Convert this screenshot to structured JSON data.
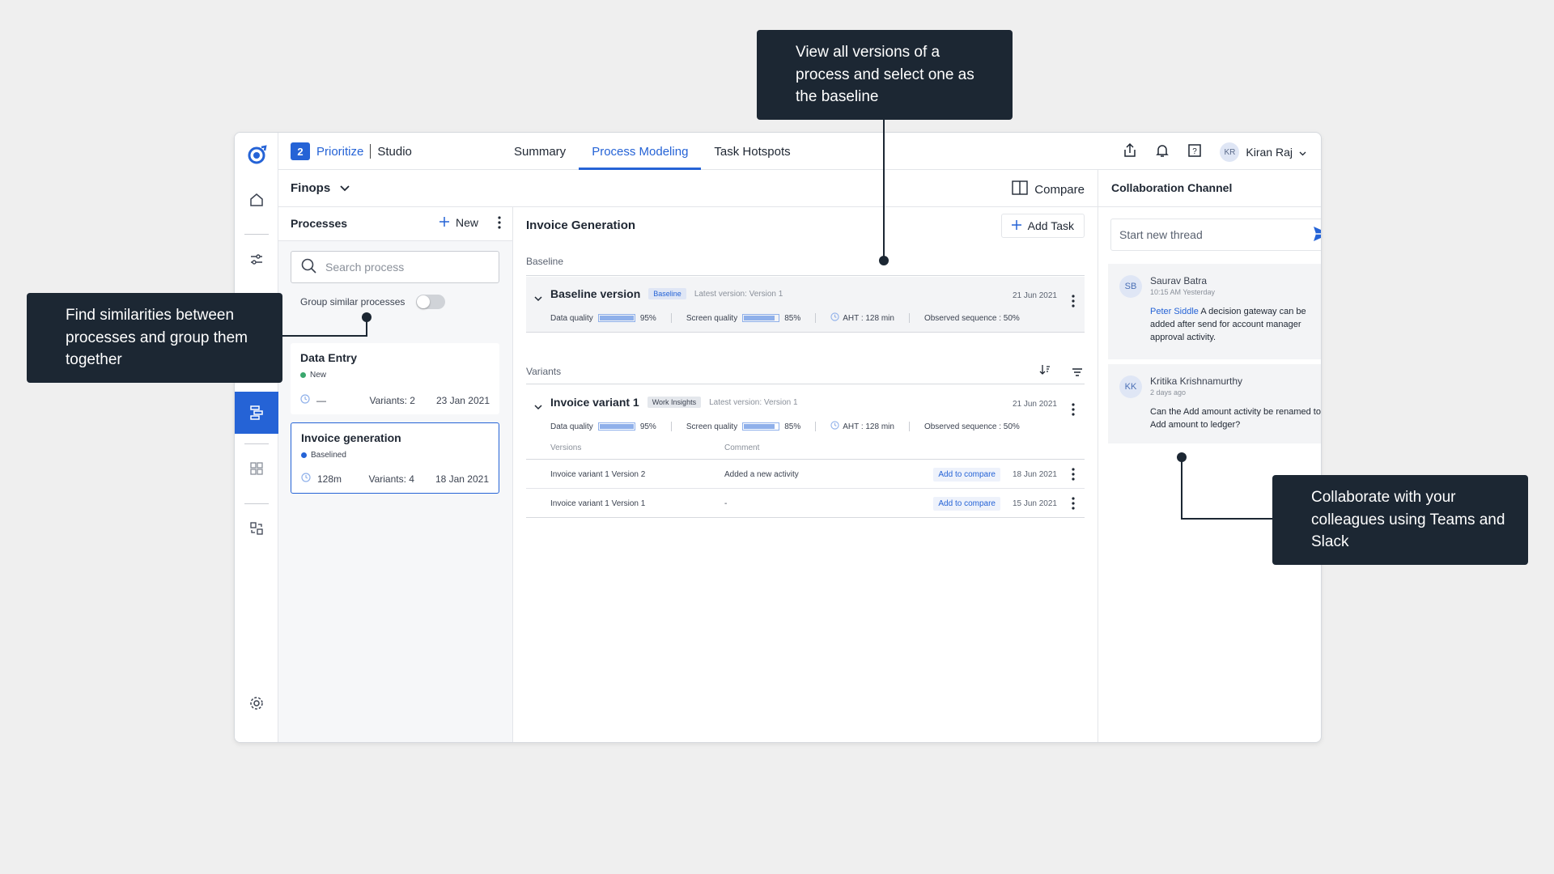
{
  "header": {
    "step_number": "2",
    "product_name": "Prioritize",
    "product_section": "Studio",
    "tabs": [
      {
        "label": "Summary"
      },
      {
        "label": "Process Modeling"
      },
      {
        "label": "Task Hotspots"
      }
    ],
    "user": {
      "initials": "KR",
      "name": "Kiran Raj"
    }
  },
  "workspace": {
    "selected": "Finops",
    "compare_label": "Compare"
  },
  "processes": {
    "title": "Processes",
    "new_label": "New",
    "search_placeholder": "Search process",
    "group_similar_label": "Group similar processes",
    "items": [
      {
        "name": "Data Entry",
        "status": "New",
        "status_color": "#3aa76d",
        "duration": "—",
        "variants": "Variants: 2",
        "date": "23 Jan 2021"
      },
      {
        "name": "Invoice generation",
        "status": "Baselined",
        "status_color": "#2563d6",
        "duration": "128m",
        "variants": "Variants: 4",
        "date": "18 Jan 2021"
      }
    ]
  },
  "detail": {
    "title": "Invoice Generation",
    "add_task_label": "Add Task",
    "baseline_section_label": "Baseline",
    "variants_section_label": "Variants",
    "baseline": {
      "name": "Baseline version",
      "badge": "Baseline",
      "latest": "Latest version: Version 1",
      "date": "21 Jun 2021",
      "data_quality_label": "Data quality",
      "data_quality": "95%",
      "data_quality_value": 0.95,
      "screen_quality_label": "Screen quality",
      "screen_quality": "85%",
      "screen_quality_value": 0.85,
      "aht": "AHT : 128 min",
      "observed": "Observed sequence : 50%"
    },
    "variant": {
      "name": "Invoice variant 1",
      "badge": "Work Insights",
      "latest": "Latest version: Version 1",
      "date": "21 Jun 2021",
      "data_quality_label": "Data quality",
      "data_quality": "95%",
      "data_quality_value": 0.95,
      "screen_quality_label": "Screen quality",
      "screen_quality": "85%",
      "screen_quality_value": 0.85,
      "aht": "AHT : 128 min",
      "observed": "Observed sequence : 50%",
      "versions_header": "Versions",
      "comment_header": "Comment",
      "versions": [
        {
          "name": "Invoice variant 1 Version 2",
          "comment": "Added a new activity",
          "action": "Add to compare",
          "date": "18 Jun 2021"
        },
        {
          "name": "Invoice variant 1 Version 1",
          "comment": "-",
          "action": "Add to compare",
          "date": "15 Jun 2021"
        }
      ]
    }
  },
  "collab": {
    "title": "Collaboration Channel",
    "thread_placeholder": "Start new thread",
    "messages": [
      {
        "initials": "SB",
        "author": "Saurav Batra",
        "time": "10:15 AM Yesterday",
        "mention": "Peter Siddle",
        "text": " A decision gateway can be added after send for account manager approval activity."
      },
      {
        "initials": "KK",
        "author": "Kritika Krishnamurthy",
        "time": "2 days ago",
        "mention": "",
        "text": "Can the Add amount activity be renamed to Add amount to ledger?"
      }
    ]
  },
  "callouts": {
    "versions": "View all versions of a process and select one as the baseline",
    "similarities": "Find similarities between processes and group them together",
    "collaborate": "Collaborate with your colleagues using Teams and Slack"
  },
  "colors": {
    "accent": "#2563d6",
    "callout_bg": "#1c2733",
    "page_bg": "#efefef"
  }
}
